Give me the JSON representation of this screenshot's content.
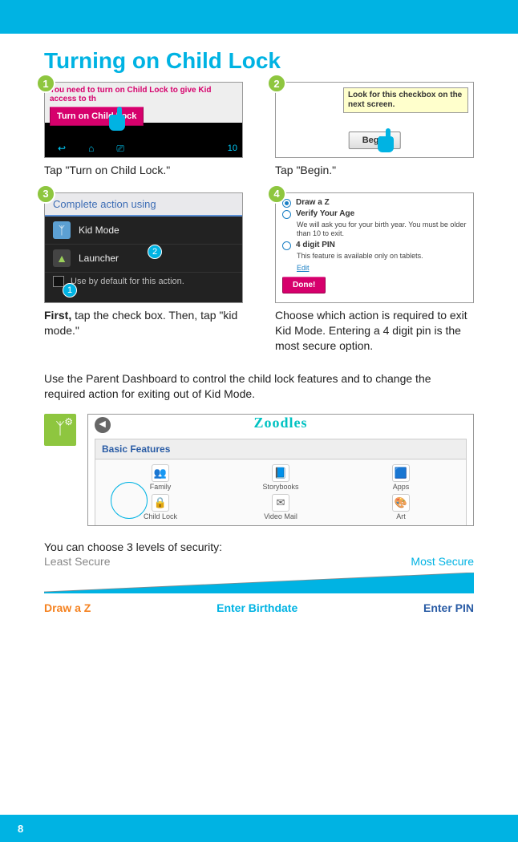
{
  "title": "Turning on Child Lock",
  "steps": [
    {
      "num": "1",
      "caption": "Tap \"Turn on Child Lock.\"",
      "alert_text": "You need to turn on Child Lock to give Kid access to th",
      "button_label": "Turn on Child Lock",
      "clock": "10"
    },
    {
      "num": "2",
      "caption": "Tap \"Begin.\"",
      "tooltip": "Look for this checkbox on the next screen.",
      "button_label": "Begin"
    },
    {
      "num": "3",
      "caption_bold": "First,",
      "caption_rest": " tap the check box. Then, tap \"kid mode.\"",
      "header": "Complete action using",
      "opt1": "Kid Mode",
      "opt2": "Launcher",
      "default_label": "Use by default for this action.",
      "marker_a": "2",
      "marker_b": "1"
    },
    {
      "num": "4",
      "caption": "Choose which action is required to exit Kid Mode. Entering a 4 digit pin is the most secure option.",
      "opt_draw": "Draw a Z",
      "opt_verify": "Verify Your Age",
      "verify_sub": "We will ask you for your birth year. You must be older than 10 to exit.",
      "opt_pin": "4 digit PIN",
      "pin_sub": "This feature is available only on tablets.",
      "edit": "Edit",
      "done": "Done!"
    }
  ],
  "paragraph": "Use the Parent Dashboard to control the child lock features and to change the required action for exiting out of Kid Mode.",
  "dashboard": {
    "banner": "Zoodles",
    "section": "Basic Features",
    "items": [
      "Family",
      "Storybooks",
      "Apps",
      "Child Lock",
      "Video Mail",
      "Art"
    ],
    "icons": [
      "👥",
      "📘",
      "🟦",
      "🔒",
      "✉",
      "🎨"
    ]
  },
  "security": {
    "intro": "You can choose 3 levels of security:",
    "least": "Least Secure",
    "most": "Most Secure",
    "opt1": "Draw a Z",
    "opt2": "Enter Birthdate",
    "opt3": "Enter PIN"
  },
  "page_number": "8"
}
